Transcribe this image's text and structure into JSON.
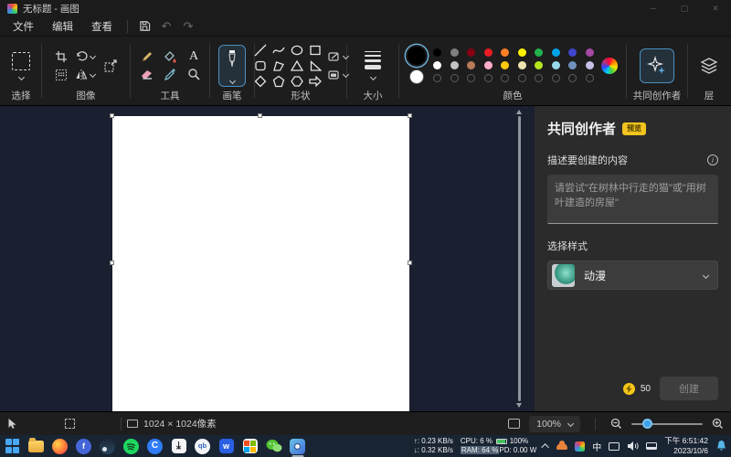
{
  "window": {
    "title": "无标题 - 画图"
  },
  "menu": {
    "file": "文件",
    "edit": "编辑",
    "view": "查看"
  },
  "toolbar": {
    "selection": "选择",
    "image": "图像",
    "tools": "工具",
    "brushes": "画笔",
    "shapes": "形状",
    "size": "大小",
    "colors": "颜色",
    "cocreator": "共同创作者",
    "layers": "层",
    "primary_color": "#000000",
    "secondary_color": "#ffffff",
    "palette_row1": [
      "#000000",
      "#7f7f7f",
      "#880015",
      "#ed1c24",
      "#ff7f27",
      "#fff200",
      "#22b14c",
      "#00a2e8",
      "#3f48cc",
      "#a349a4"
    ],
    "palette_row2": [
      "#ffffff",
      "#c3c3c3",
      "#b97a57",
      "#ffaec9",
      "#ffc90e",
      "#efe4b0",
      "#b5e61d",
      "#99d9ea",
      "#7092be",
      "#c8bfe7"
    ],
    "tool_names": [
      "pencil",
      "fill",
      "text",
      "eraser",
      "color-picker",
      "magnifier"
    ],
    "shape_names": [
      "line",
      "curve",
      "oval",
      "rectangle",
      "rounded-rectangle",
      "polygon",
      "triangle",
      "right-triangle",
      "diamond",
      "pentagon",
      "hexagon",
      "right-arrow"
    ]
  },
  "cocreator": {
    "title": "共同创作者",
    "badge": "预览",
    "describe_label": "描述要创建的内容",
    "prompt_placeholder": "请尝试\"在树林中行走的猫\"或\"用树叶建造的房屋\"",
    "style_label": "选择样式",
    "style_selected": "动漫",
    "credits": "50",
    "create_label": "创建"
  },
  "statusbar": {
    "canvas_size": "1024 × 1024像素",
    "zoom": "100%"
  },
  "taskbar": {
    "apps": [
      "start",
      "file-explorer",
      "firefox",
      "files-app",
      "steam",
      "spotify",
      "browser-c",
      "downloader",
      "qbittorrent",
      "w-app",
      "microsoft-store",
      "wechat",
      "paint"
    ],
    "tray": {
      "up": "↑: 0.23 KB/s",
      "down": "↓: 0.32 KB/s",
      "cpu": "CPU: 6 %",
      "ram": "RAM: 64 %",
      "battery": "100%",
      "pd": "PD: 0.00 W",
      "ime": "中",
      "time": "下午 6:51:42",
      "date": "2023/10/6"
    }
  }
}
